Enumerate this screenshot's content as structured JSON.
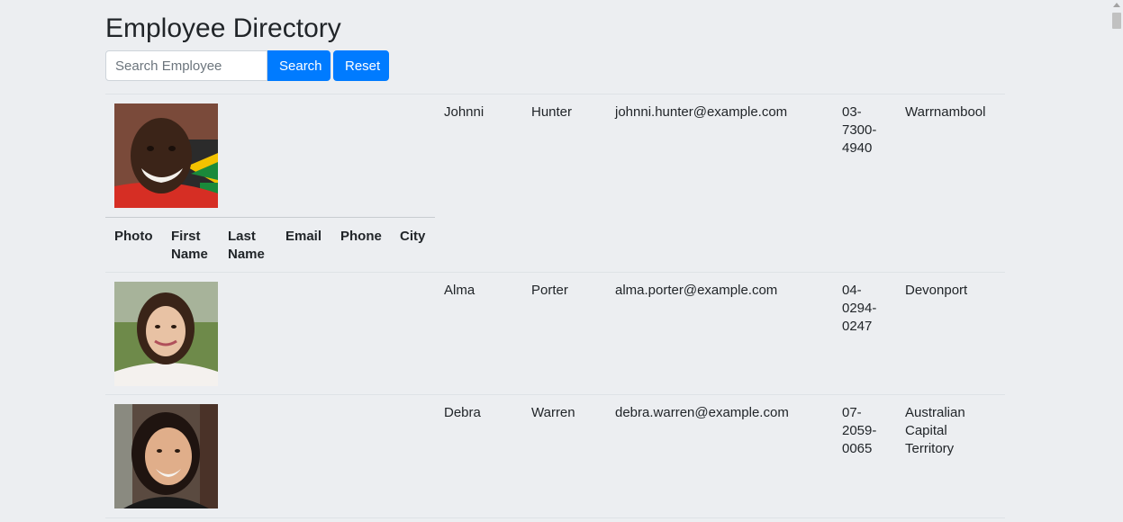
{
  "header": {
    "title": "Employee Directory"
  },
  "search": {
    "placeholder": "Search Employee",
    "value": "",
    "search_label": "Search",
    "reset_label": "Reset"
  },
  "table": {
    "columns": [
      "Photo",
      "First Name",
      "Last Name",
      "Email",
      "Phone",
      "City"
    ],
    "nested_header": {
      "photo": "Photo",
      "first_1": "First",
      "first_2": "Name",
      "last_1": "Last",
      "last_2": "Name",
      "email": "Email",
      "phone": "Phone",
      "city": "City"
    },
    "rows": [
      {
        "first": "Johnni",
        "last": "Hunter",
        "email": "johnni.hunter@example.com",
        "phone_lines": [
          "03-",
          "7300-",
          "4940"
        ],
        "city_lines": [
          "Warrnambool"
        ]
      },
      {
        "first": "Alma",
        "last": "Porter",
        "email": "alma.porter@example.com",
        "phone_lines": [
          "04-",
          "0294-",
          "0247"
        ],
        "city_lines": [
          "Devonport"
        ]
      },
      {
        "first": "Debra",
        "last": "Warren",
        "email": "debra.warren@example.com",
        "phone_lines": [
          "07-",
          "2059-",
          "0065"
        ],
        "city_lines": [
          "Australian",
          "Capital",
          "Territory"
        ]
      }
    ]
  },
  "colors": {
    "background": "#eceef1",
    "primary": "#007bff",
    "text": "#212529"
  }
}
